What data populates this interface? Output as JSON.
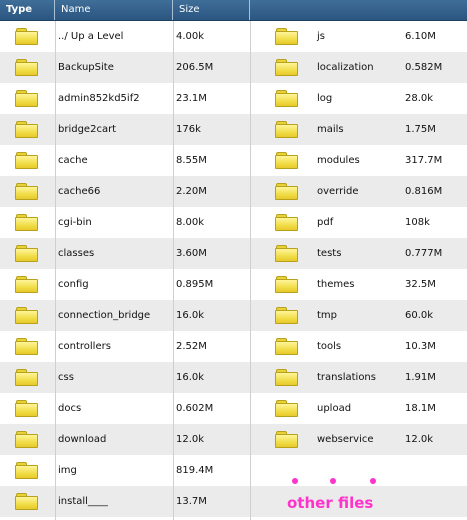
{
  "header": {
    "type_label": "Type",
    "name_label": "Name",
    "size_label": "Size"
  },
  "icon_name": "folder-icon",
  "colors": {
    "header_bg": "#2f5d87",
    "row_alt": "#ebebeb",
    "folder": "#f1dd48",
    "annotation": "#ff33cc"
  },
  "left_column": [
    {
      "name": "../ Up a Level",
      "size": "4.00k"
    },
    {
      "name": "BackupSite",
      "size": "206.5M"
    },
    {
      "name": "admin852kd5if2",
      "size": "23.1M"
    },
    {
      "name": "bridge2cart",
      "size": "176k"
    },
    {
      "name": "cache",
      "size": "8.55M"
    },
    {
      "name": "cache66",
      "size": "2.20M"
    },
    {
      "name": "cgi-bin",
      "size": "8.00k"
    },
    {
      "name": "classes",
      "size": "3.60M"
    },
    {
      "name": "config",
      "size": "0.895M"
    },
    {
      "name": "connection_bridge",
      "size": "16.0k"
    },
    {
      "name": "controllers",
      "size": "2.52M"
    },
    {
      "name": "css",
      "size": "16.0k"
    },
    {
      "name": "docs",
      "size": "0.602M"
    },
    {
      "name": "download",
      "size": "12.0k"
    },
    {
      "name": "img",
      "size": "819.4M"
    },
    {
      "name": "install____",
      "size": "13.7M"
    }
  ],
  "right_column": [
    {
      "name": "js",
      "size": "6.10M"
    },
    {
      "name": "localization",
      "size": "0.582M"
    },
    {
      "name": "log",
      "size": "28.0k"
    },
    {
      "name": "mails",
      "size": "1.75M"
    },
    {
      "name": "modules",
      "size": "317.7M"
    },
    {
      "name": "override",
      "size": "0.816M"
    },
    {
      "name": "pdf",
      "size": "108k"
    },
    {
      "name": "tests",
      "size": "0.777M"
    },
    {
      "name": "themes",
      "size": "32.5M"
    },
    {
      "name": "tmp",
      "size": "60.0k"
    },
    {
      "name": "tools",
      "size": "10.3M"
    },
    {
      "name": "translations",
      "size": "1.91M"
    },
    {
      "name": "upload",
      "size": "18.1M"
    },
    {
      "name": "webservice",
      "size": "12.0k"
    }
  ],
  "annotation": {
    "text": "other files"
  }
}
